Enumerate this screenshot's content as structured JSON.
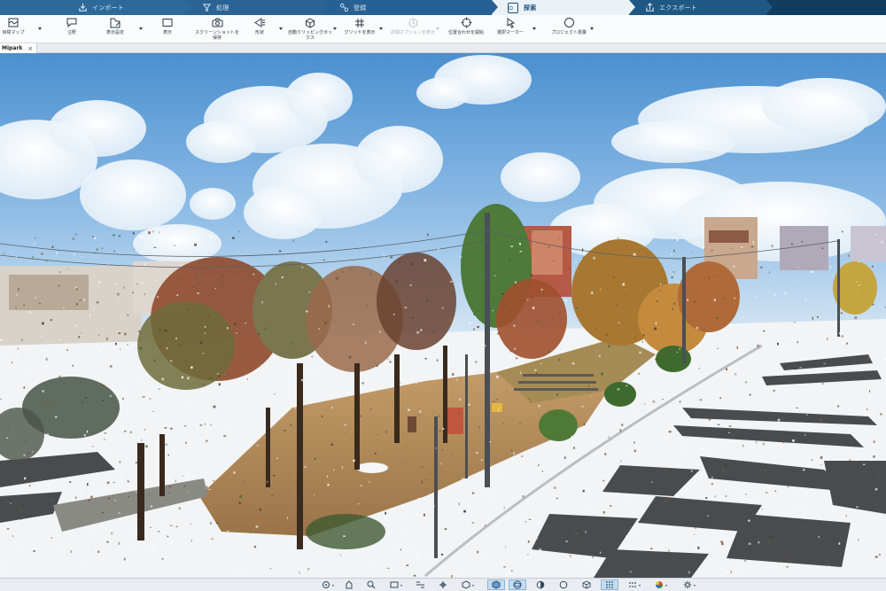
{
  "steps": [
    {
      "label": "インポート",
      "icon": "import-icon"
    },
    {
      "label": "処理",
      "icon": "process-icon"
    },
    {
      "label": "登録",
      "icon": "register-icon"
    },
    {
      "label": "探索",
      "icon": "explore-icon",
      "active": true
    },
    {
      "label": "エクスポート",
      "icon": "export-icon"
    }
  ],
  "ribbon": {
    "tools": [
      {
        "label": "目標マップ",
        "icon": "map-icon"
      },
      {
        "label": "注釈",
        "icon": "annotation-icon"
      },
      {
        "label": "表示設定",
        "icon": "display-settings-icon"
      },
      {
        "label": "表示",
        "icon": "view-icon"
      },
      {
        "label": "スクリーンショットを保存",
        "icon": "camera-icon"
      },
      {
        "label": "形状",
        "icon": "shape-icon"
      },
      {
        "label": "自動クリッピングボックス",
        "icon": "clipping-box-icon"
      },
      {
        "label": "グリッドを表示",
        "icon": "grid-icon"
      },
      {
        "label": "詳細オプションを表示",
        "icon": "options-icon",
        "disabled": true
      },
      {
        "label": "位置合わせを開始",
        "icon": "target-icon"
      },
      {
        "label": "選択マーカー",
        "icon": "cursor-icon"
      },
      {
        "label": "プロジェクト測量",
        "icon": "survey-icon"
      }
    ]
  },
  "document_tab": {
    "label": "Mipark"
  },
  "bottom_tools": [
    {
      "icon": "orbit-icon"
    },
    {
      "icon": "pan-icon"
    },
    {
      "icon": "zoom-icon"
    },
    {
      "icon": "screen-icon"
    },
    {
      "icon": "fit-view-icon"
    },
    {
      "icon": "point-select-icon"
    },
    {
      "icon": "cube-top-icon"
    },
    {
      "icon": "cube-view-icon",
      "active": true
    },
    {
      "icon": "sphere-view-icon",
      "active": true
    },
    {
      "icon": "half-circle-icon"
    },
    {
      "icon": "circle-icon"
    },
    {
      "icon": "cube-outline-icon"
    },
    {
      "icon": "grid-dots-icon",
      "active": true
    },
    {
      "icon": "dots-icon"
    },
    {
      "icon": "color-wheel-icon"
    },
    {
      "icon": "settings-icon"
    }
  ],
  "colors": {
    "stepbar": "#1b4f78",
    "active_step": "#eaf2f8",
    "ribbon": "#fbfcfd",
    "sky": "#5d9bd4",
    "ground": "#f2f4f6",
    "dirt": "#b08a5e"
  }
}
